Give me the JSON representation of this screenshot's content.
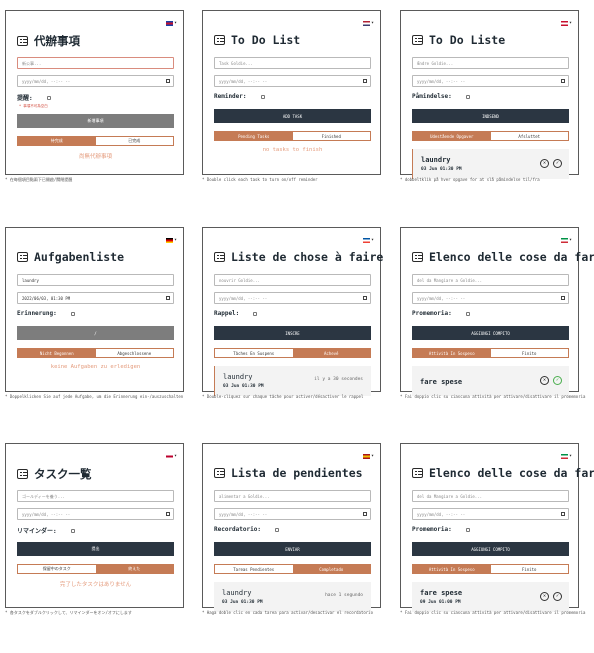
{
  "screens": [
    {
      "lang": "zh-TW",
      "flag": [
        "#1a3fa8",
        "#c8102e",
        "#1a3fa8"
      ],
      "title": "代辦事項",
      "placeholder": "新公事...",
      "date": "yyyy/mm/dd, --:-- --",
      "reminder": "提醒:",
      "error": "* 事項不可為空白",
      "submit": "新增事項",
      "submit_style": "gray",
      "tabs": [
        "待完成",
        "已完成"
      ],
      "active_tab": 0,
      "empty": "尚無代辦事項",
      "task": null,
      "caption": "* 在每個項目點兩下已開啟/關閉提醒"
    },
    {
      "lang": "en",
      "flag": [
        "#b22234",
        "#ffffff",
        "#3c3b6e"
      ],
      "title": "To Do List",
      "placeholder": "Task Goldie...",
      "date": "yyyy/mm/dd, --:-- --",
      "reminder": "Reminder:",
      "error": "",
      "submit": "ADD TASK",
      "submit_style": "dark",
      "tabs": [
        "Pending Tasks",
        "Finished"
      ],
      "active_tab": 0,
      "empty": "no tasks to finish",
      "task": null,
      "caption": "* Double click each task to turn on/off reminder"
    },
    {
      "lang": "da",
      "flag": [
        "#c8102e",
        "#ffffff",
        "#c8102e"
      ],
      "title": "To Do Liste",
      "placeholder": "Ændre Goldie...",
      "date": "yyyy/mm/dd, --:-- --",
      "reminder": "Påmindelse:",
      "error": "",
      "submit": "INDSEND",
      "submit_style": "dark",
      "tabs": [
        "Udestående Opgaver",
        "Afsluttet"
      ],
      "active_tab": 0,
      "empty": "",
      "task": {
        "name": "laundry",
        "date": "03 Jun 01:30 PM",
        "left": "",
        "bold": true,
        "bar": true,
        "actions": true,
        "green": false
      },
      "caption": "* dobbeltklik på hver opgave for at slå påmindelse til/fra"
    },
    {
      "lang": "de",
      "flag": [
        "#000000",
        "#dd0000",
        "#ffce00"
      ],
      "title": "Aufgabenliste",
      "placeholder": "laundry",
      "date": "2022/06/03, 01:30 PM",
      "reminder": "Erinnerung:",
      "error": "",
      "submit": "/",
      "submit_style": "gray",
      "tabs": [
        "Nicht Begonnen",
        "Abgeschlossene"
      ],
      "active_tab": 0,
      "empty": "keine Aufgaben zu erledigen",
      "task": null,
      "caption": "* Doppelklicken Sie auf jede Aufgabe, um die Erinnerung ein-/auszuschalten"
    },
    {
      "lang": "fr",
      "flag": [
        "#0055a4",
        "#ffffff",
        "#ef4135"
      ],
      "title": "Liste de chose à faire",
      "placeholder": "nouvrir Goldie...",
      "date": "yyyy/mm/dd, --:-- --",
      "reminder": "Rappel:",
      "error": "",
      "submit": "INSCRE",
      "submit_style": "dark",
      "tabs": [
        "Tâches En Suspens",
        "Achevé"
      ],
      "active_tab": 1,
      "empty": "",
      "task": {
        "name": "laundry",
        "date": "03 Jun 01:30 PM",
        "left": "il y a 30 secondes",
        "bold": false,
        "bar": true,
        "actions": false,
        "green": false
      },
      "caption": "* Double-cliquez sur chaque tâche pour activer/désactiver le rappel"
    },
    {
      "lang": "it",
      "flag": [
        "#009246",
        "#ffffff",
        "#ce2b37"
      ],
      "title": "Elenco delle cose da fare",
      "placeholder": "del da Mangiare a Goldie...",
      "date": "yyyy/mm/dd, --:-- --",
      "reminder": "Promemoria:",
      "error": "",
      "submit": "AGGIUNGI COMPITO",
      "submit_style": "dark",
      "tabs": [
        "Attività In Sospeso",
        "Finito"
      ],
      "active_tab": 0,
      "empty": "",
      "task": {
        "name": "fare spese",
        "date": "",
        "left": "",
        "bold": true,
        "bar": false,
        "actions": true,
        "green": true
      },
      "caption": "* Fai doppio clic su ciascuna attività per attivare/disattivare il promemoria"
    },
    {
      "lang": "ja",
      "flag": [
        "#ffffff",
        "#bc002d",
        "#ffffff"
      ],
      "title": "タスク一覧",
      "placeholder": "ゴールディーを養う...",
      "date": "yyyy/mm/dd, --:-- --",
      "reminder": "リマインダー:",
      "error": "",
      "submit": "提出",
      "submit_style": "dark",
      "tabs": [
        "保留中のタスク",
        "終えた"
      ],
      "active_tab": 1,
      "empty": "完了したタスクはありません",
      "task": null,
      "caption": "* 各タスクをダブルクリックして、リマインダーをオン/オフにします"
    },
    {
      "lang": "es",
      "flag": [
        "#aa151b",
        "#f1bf00",
        "#aa151b"
      ],
      "title": "Lista de pendientes",
      "placeholder": "alimentar a Goldie...",
      "date": "yyyy/mm/dd, --:-- --",
      "reminder": "Recordatorio:",
      "error": "",
      "submit": "ENVIAR",
      "submit_style": "dark",
      "tabs": [
        "Tareas Pendientes",
        "Completado"
      ],
      "active_tab": 1,
      "empty": "",
      "task": {
        "name": "laundry",
        "date": "03 Jun 01:30 PM",
        "left": "hace 1 segundo",
        "bold": false,
        "bar": false,
        "actions": false,
        "green": false
      },
      "caption": "* Haga doble clic en cada tarea para activar/desactivar el recordatorio"
    },
    {
      "lang": "it",
      "flag": [
        "#009246",
        "#ffffff",
        "#ce2b37"
      ],
      "title": "Elenco delle cose da fare",
      "placeholder": "del da Mangiare a Goldie...",
      "date": "yyyy/mm/dd, --:-- --",
      "reminder": "Promemoria:",
      "error": "",
      "submit": "AGGIUNGI COMPITO",
      "submit_style": "dark",
      "tabs": [
        "Attività In Sospeso",
        "Finito"
      ],
      "active_tab": 0,
      "empty": "",
      "task": {
        "name": "fare spese",
        "date": "09 Jun 01:00 PM",
        "left": "",
        "bold": true,
        "bar": false,
        "actions": true,
        "green": false
      },
      "caption": "* Fai doppio clic su ciascuna attività per attivare/disattivare il promemoria"
    }
  ]
}
